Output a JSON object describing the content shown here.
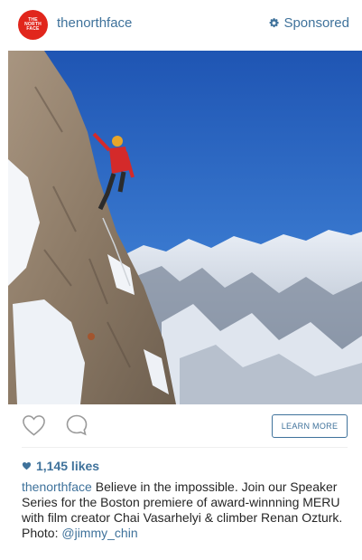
{
  "post": {
    "avatar_text": "THE NORTH FACE",
    "username": "thenorthface",
    "sponsored_label": "Sponsored",
    "cta_label": "LEARN MORE",
    "likes_text": "1,145 likes",
    "caption": {
      "username": "thenorthface",
      "text": " Believe in the impossible. Join our Speaker Series for the Boston premiere of award-winnning MERU with film creator Chai Vasarhelyi & climber Renan Ozturk. Photo: ",
      "mention": "@jimmy_chin"
    }
  },
  "icons": {
    "sponsored": "gear-icon",
    "like": "heart-outline-icon",
    "comment": "comment-bubble-icon",
    "likes": "heart-filled-icon"
  },
  "colors": {
    "link": "#3f729b",
    "brand": "#e1261c",
    "text": "#262626",
    "sky": "#2a5fb8"
  }
}
